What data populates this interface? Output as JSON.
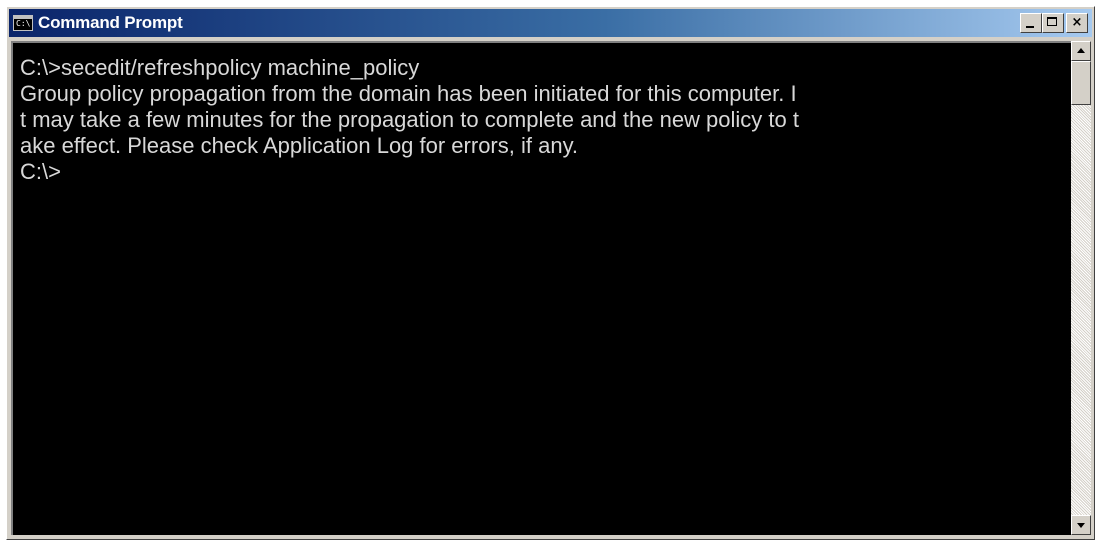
{
  "window": {
    "title": "Command Prompt",
    "icon": "command-prompt-icon",
    "icon_glyph": "C:\\",
    "buttons": {
      "minimize": "minimize-icon",
      "maximize": "maximize-icon",
      "close": "close-icon",
      "close_glyph": "×"
    }
  },
  "console": {
    "lines": [
      "C:\\>secedit/refreshpolicy machine_policy",
      "Group policy propagation from the domain has been initiated for this computer. I",
      "t may take a few minutes for the propagation to complete and the new policy to t",
      "ake effect. Please check Application Log for errors, if any.",
      "C:\\>"
    ]
  },
  "scrollbar": {
    "position": 0
  },
  "colors": {
    "titlebar_start": "#0a246a",
    "titlebar_end": "#a6caf0",
    "console_background": "#000000",
    "console_text": "#d8d8d8",
    "chrome": "#d4d0c8"
  }
}
